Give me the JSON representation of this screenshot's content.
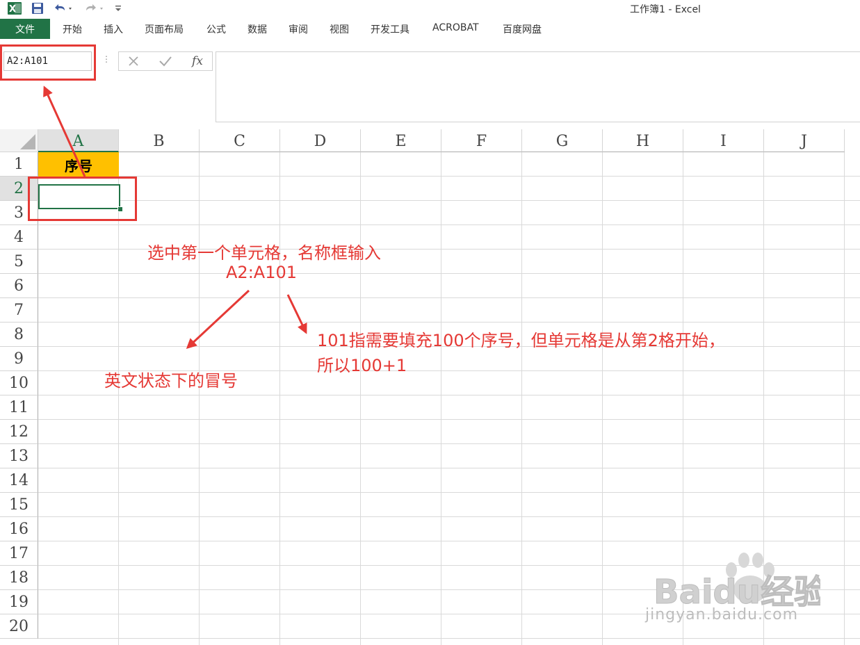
{
  "window": {
    "title": "工作簿1 - Excel"
  },
  "qat": {
    "icons": [
      "excel-logo-icon",
      "save-icon",
      "undo-icon",
      "redo-icon",
      "customize-qat-icon"
    ]
  },
  "ribbon": {
    "file_tab": "文件",
    "tabs": [
      "开始",
      "插入",
      "页面布局",
      "公式",
      "数据",
      "审阅",
      "视图",
      "开发工具",
      "ACROBAT",
      "百度网盘"
    ]
  },
  "formula_bar": {
    "name_box_value": "A2:A101",
    "cancel_icon": "cancel-icon",
    "enter_icon": "check-icon",
    "function_label": "fx",
    "formula_value": ""
  },
  "sheet": {
    "columns": [
      "A",
      "B",
      "C",
      "D",
      "E",
      "F",
      "G",
      "H",
      "I",
      "J"
    ],
    "rows": [
      "1",
      "2",
      "3",
      "4",
      "5",
      "6",
      "7",
      "8",
      "9",
      "10",
      "11",
      "12",
      "13",
      "14",
      "15",
      "16",
      "17",
      "18",
      "19",
      "20"
    ],
    "active_column": "A",
    "active_row": "2",
    "cells": {
      "A1": "序号",
      "A2": ""
    },
    "header_fill_color": "#ffc000",
    "selection_color": "#217346"
  },
  "annotations": {
    "line1": "选中第一个单元格，名称框输入",
    "line2": "A2:A101",
    "colon_note": "英文状态下的冒号",
    "explain_line1": "101指需要填充100个序号，但单元格是从第2格开始，",
    "explain_line2": "所以100+1",
    "color": "#e53935"
  },
  "watermark": {
    "brand": "Baidu经验",
    "url": "jingyan.baidu.com"
  }
}
